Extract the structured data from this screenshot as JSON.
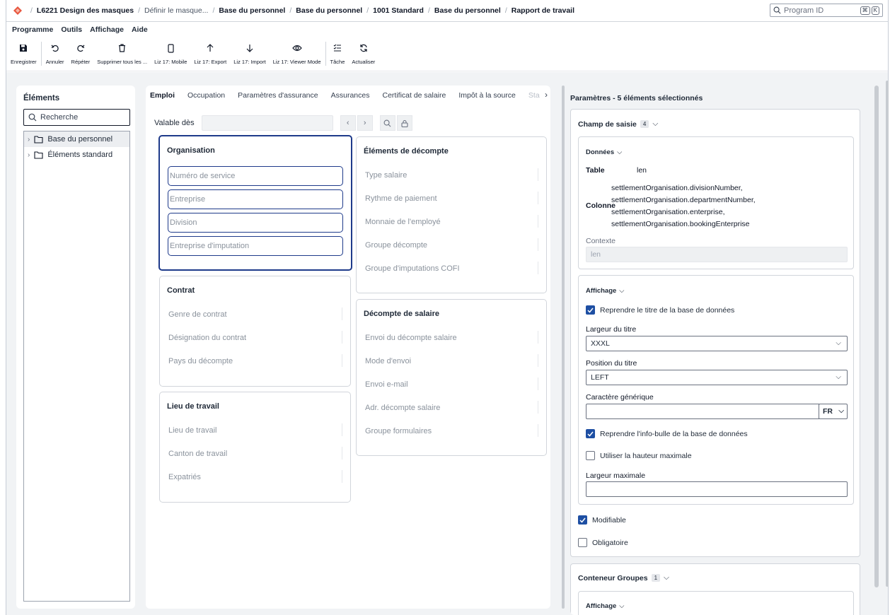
{
  "breadcrumb": [
    "L6221 Design des masques",
    "Définir le masque...",
    "Base du personnel",
    "Base du personnel",
    "1001 Standard",
    "Base du personnel",
    "Rapport de travail"
  ],
  "search": {
    "placeholder": "Program ID",
    "shortcut_key1": "⌘",
    "shortcut_key2": "K"
  },
  "menu": [
    "Programme",
    "Outils",
    "Affichage",
    "Aide"
  ],
  "toolbar": {
    "save": "Enregistrer",
    "undo": "Annuler",
    "redo": "Répéter",
    "delete_all": "Supprimer tous les ...",
    "mobile": "Liz 17: Mobile",
    "export": "Liz 17: Export",
    "import": "Liz 17: Import",
    "viewer": "Liz 17: Viewer Mode",
    "task": "Tâche",
    "refresh": "Actualiser"
  },
  "left": {
    "title": "Éléments",
    "search_value": "Recherche",
    "tree": [
      "Base du personnel",
      "Éléments standard"
    ]
  },
  "tabs": [
    "Emploi",
    "Occupation",
    "Paramètres d'assurance",
    "Assurances",
    "Certificat de salaire",
    "Impôt à la source",
    "Sta"
  ],
  "valid_from": "Valable dès",
  "groups": {
    "organisation": {
      "title": "Organisation",
      "fields": [
        "Numéro de service",
        "Entreprise",
        "Division",
        "Entreprise d'imputation"
      ]
    },
    "contrat": {
      "title": "Contrat",
      "fields": [
        "Genre de contrat",
        "Désignation du contrat",
        "Pays du décompte"
      ]
    },
    "lieu": {
      "title": "Lieu de travail",
      "fields": [
        "Lieu de travail",
        "Canton de travail",
        "Expatriés"
      ]
    },
    "decompte": {
      "title": "Éléments de décompte",
      "fields": [
        "Type salaire",
        "Rythme de paiement",
        "Monnaie de l'employé",
        "Groupe décompte",
        "Groupe d'imputations COFI"
      ]
    },
    "salaire": {
      "title": "Décompte de salaire",
      "fields": [
        "Envoi du décompte salaire",
        "Mode d'envoi",
        "Envoi e-mail",
        "Adr. décompte salaire",
        "Groupe formulaires"
      ]
    }
  },
  "params": {
    "title": "Paramètres - 5 éléments sélectionnés",
    "champ": {
      "title": "Champ de saisie",
      "count": "4"
    },
    "donnees": {
      "title": "Données",
      "table_label": "Table",
      "table_value": "len",
      "column_label": "Colonne",
      "columns": [
        "settlementOrganisation.divisionNumber,",
        "settlementOrganisation.departmentNumber,",
        "settlementOrganisation.enterprise,",
        "settlementOrganisation.bookingEnterprise"
      ],
      "context_label": "Contexte",
      "context_value": "len"
    },
    "affichage": {
      "title": "Affichage",
      "chk_title": "Reprendre le titre de la base de données",
      "largeur_label": "Largeur du titre",
      "largeur_value": "XXXL",
      "position_label": "Position du titre",
      "position_value": "LEFT",
      "generic_label": "Caractère générique",
      "lang": "FR",
      "chk_tooltip": "Reprendre l'info-bulle de la base de données",
      "chk_height": "Utiliser la hauteur maximale",
      "maxwidth_label": "Largeur maximale"
    },
    "modifiable": "Modifiable",
    "obligatoire": "Obligatoire",
    "conteneur": {
      "title": "Conteneur Groupes",
      "count": "1",
      "affichage": "Affichage"
    }
  }
}
